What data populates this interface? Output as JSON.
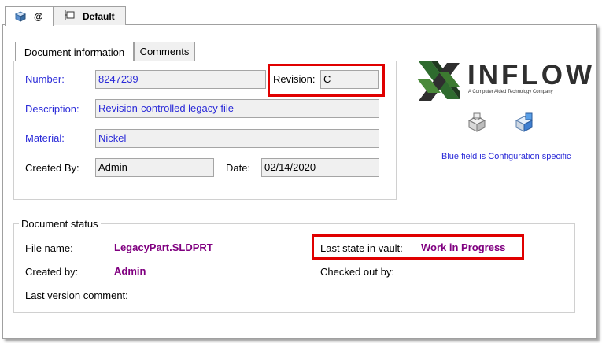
{
  "top_tabs": {
    "tab1_label": "@",
    "tab2_label": "Default"
  },
  "doc_tabs": {
    "info": "Document information",
    "comments": "Comments"
  },
  "fields": {
    "number_label": "Number:",
    "number_value": "8247239",
    "revision_label": "Revision:",
    "revision_value": "C",
    "description_label": "Description:",
    "description_value": "Revision-controlled legacy file",
    "material_label": "Material:",
    "material_value": "Nickel",
    "created_by_label": "Created By:",
    "created_by_value": "Admin",
    "date_label": "Date:",
    "date_value": "02/14/2020"
  },
  "logo": {
    "name": "INFLOW",
    "tagline": "A Computer Aided Technology Company"
  },
  "config_note": "Blue field is Configuration specific",
  "status": {
    "title": "Document status",
    "file_name_label": "File name:",
    "file_name_value": "LegacyPart.SLDPRT",
    "created_by_label": "Created by:",
    "created_by_value": "Admin",
    "last_comment_label": "Last version comment:",
    "last_state_label": "Last state in vault:",
    "last_state_value": "Work in Progress",
    "checked_out_label": "Checked out by:"
  },
  "colors": {
    "config_blue": "#2a2ad8",
    "status_purple": "#800080",
    "highlight_red": "#e00000",
    "logo_green": "#2e6b2e"
  }
}
